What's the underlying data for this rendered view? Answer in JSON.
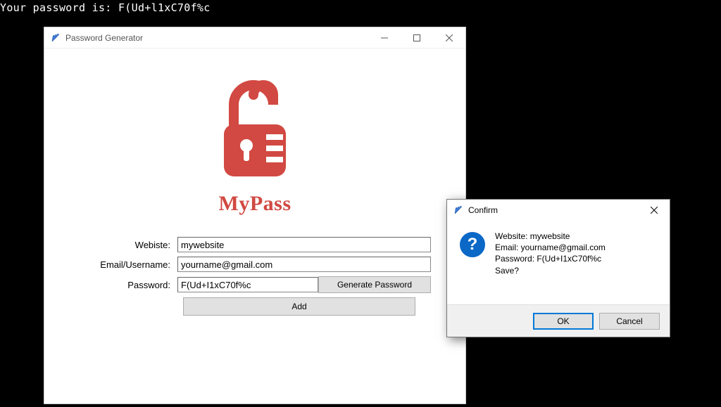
{
  "terminal": {
    "line": "Your password is: F(Ud+l1xC70f%c"
  },
  "mainWindow": {
    "title": "Password Generator",
    "logo": {
      "text": "MyPass",
      "color": "#d14942"
    },
    "form": {
      "websiteLabel": "Webiste:",
      "websiteValue": "mywebsite",
      "emailLabel": "Email/Username:",
      "emailValue": "yourname@gmail.com",
      "passwordLabel": "Password:",
      "passwordValue": "F(Ud+I1xC70f%c",
      "generateButton": "Generate Password",
      "addButton": "Add"
    }
  },
  "dialog": {
    "title": "Confirm",
    "message": {
      "line1": "Website: mywebsite",
      "line2": "Email: yourname@gmail.com",
      "line3": "Password: F(Ud+I1xC70f%c",
      "line4": "Save?"
    },
    "okButton": "OK",
    "cancelButton": "Cancel"
  }
}
